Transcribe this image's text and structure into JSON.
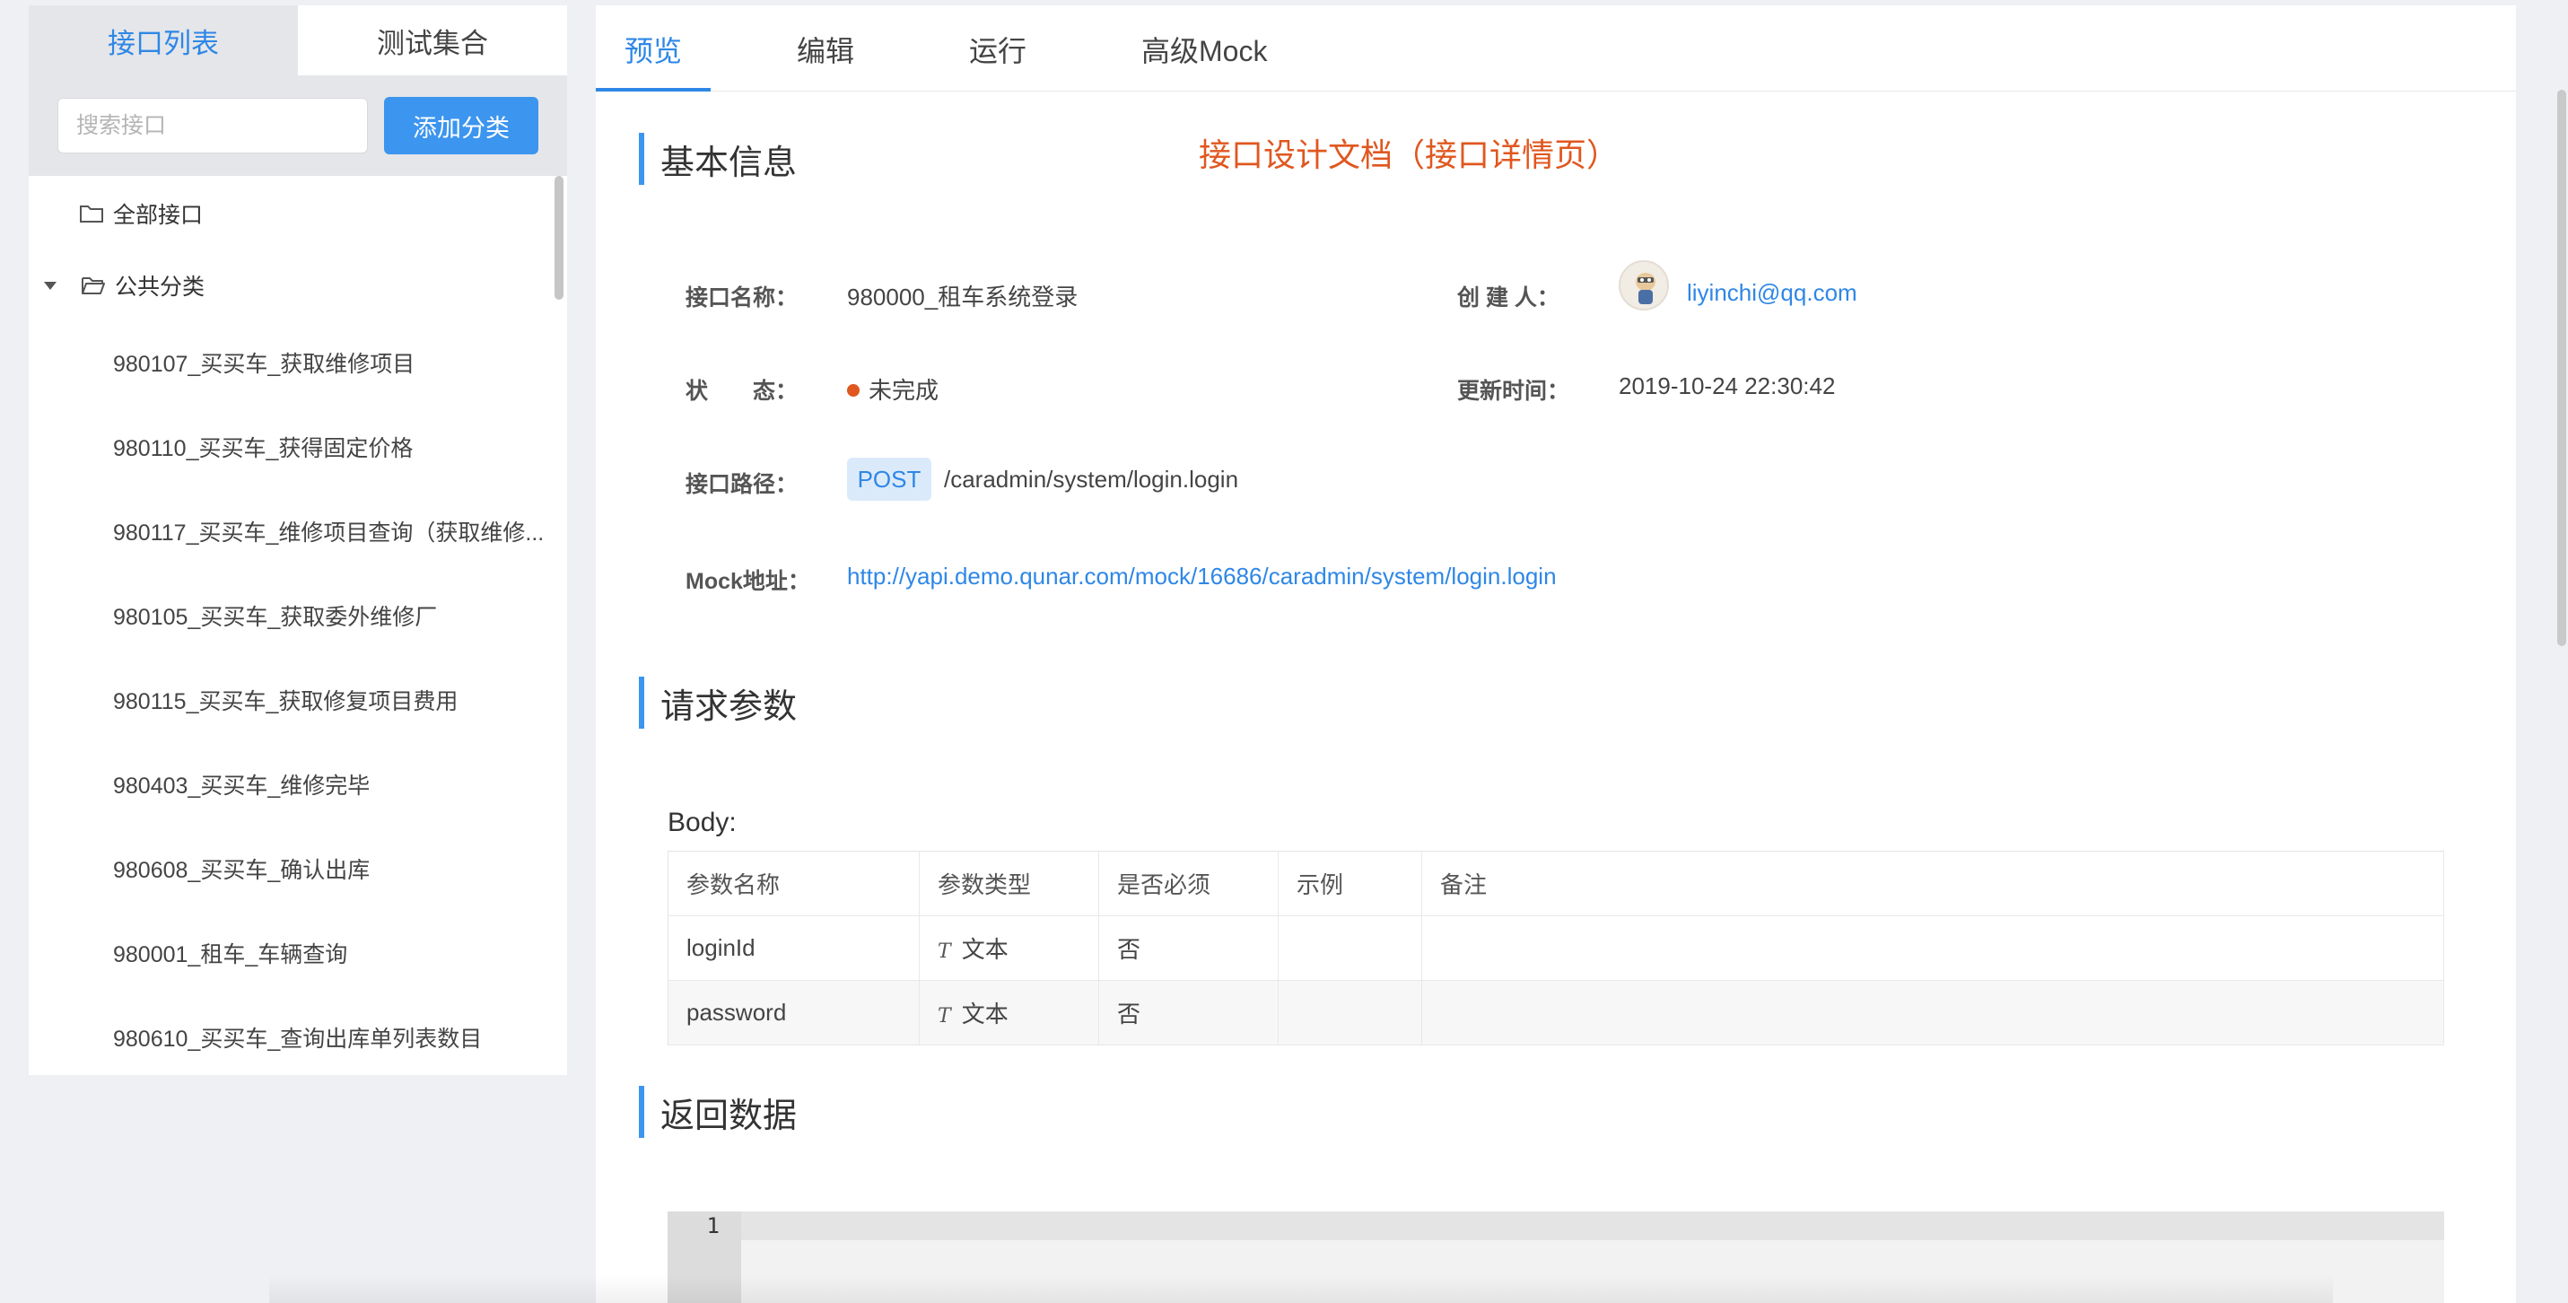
{
  "left_panel": {
    "tabs": [
      {
        "label": "接口列表",
        "active": true
      },
      {
        "label": "测试集合",
        "active": false
      }
    ],
    "search": {
      "placeholder": "搜索接口",
      "value": ""
    },
    "add_category_label": "添加分类",
    "tree": {
      "all_label": "全部接口",
      "category_label": "公共分类",
      "items": [
        "980107_买买车_获取维修项目",
        "980110_买买车_获得固定价格",
        "980117_买买车_维修项目查询（获取维修...",
        "980105_买买车_获取委外维修厂",
        "980115_买买车_获取修复项目费用",
        "980403_买买车_维修完毕",
        "980608_买买车_确认出库",
        "980001_租车_车辆查询",
        "980610_买买车_查询出库单列表数目"
      ]
    }
  },
  "main": {
    "tabs": [
      {
        "label": "预览",
        "active": true
      },
      {
        "label": "编辑",
        "active": false
      },
      {
        "label": "运行",
        "active": false
      },
      {
        "label": "高级Mock",
        "active": false
      }
    ],
    "annotation": "接口设计文档（接口详情页）",
    "basic_info": {
      "title": "基本信息",
      "name_label": "接口名称：",
      "name_value": "980000_租车系统登录",
      "creator_label": "创 建 人：",
      "creator_value": "liyinchi@qq.com",
      "status_label": "状　　态：",
      "status_value": "未完成",
      "status_color": "#e0571f",
      "updated_label": "更新时间：",
      "updated_value": "2019-10-24 22:30:42",
      "path_label": "接口路径：",
      "method": "POST",
      "path_value": "/caradmin/system/login.login",
      "mock_label": "Mock地址：",
      "mock_value": "http://yapi.demo.qunar.com/mock/16686/caradmin/system/login.login"
    },
    "request": {
      "title": "请求参数",
      "body_label": "Body:",
      "columns": [
        "参数名称",
        "参数类型",
        "是否必须",
        "示例",
        "备注"
      ],
      "rows": [
        {
          "name": "loginId",
          "type": "文本",
          "required": "否",
          "example": "",
          "note": ""
        },
        {
          "name": "password",
          "type": "文本",
          "required": "否",
          "example": "",
          "note": ""
        }
      ]
    },
    "response": {
      "title": "返回数据",
      "line_number": "1"
    }
  },
  "colors": {
    "accent": "#2e87e6",
    "button": "#3c95ee",
    "annotation": "#e0571f"
  }
}
